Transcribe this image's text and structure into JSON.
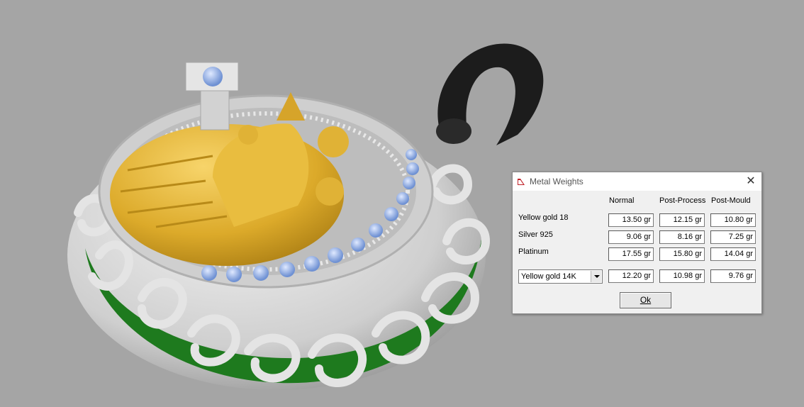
{
  "dialog": {
    "title": "Metal Weights",
    "close_glyph": "✕",
    "columns": [
      "Normal",
      "Post-Process",
      "Post-Mould"
    ],
    "rows": [
      {
        "label": "Yellow gold 18",
        "values": [
          "13.50 gr",
          "12.15 gr",
          "10.80 gr"
        ]
      },
      {
        "label": "Silver 925",
        "values": [
          "9.06 gr",
          "8.16 gr",
          "7.25 gr"
        ]
      },
      {
        "label": "Platinum",
        "values": [
          "17.55 gr",
          "15.80 gr",
          "14.04 gr"
        ]
      }
    ],
    "custom": {
      "selected_metal": "Yellow gold 14K",
      "values": [
        "12.20 gr",
        "10.98 gr",
        "9.76 gr"
      ]
    },
    "ok_label": "Ok"
  },
  "viewport": {
    "background_color": "#a5a5a5",
    "model": "pendant",
    "colors": {
      "silver": "#d8d8d8",
      "gold": "#e2b431",
      "enamel": "#1e7a1e",
      "stones": "#8fb0e6",
      "bail": "#1c1c1c"
    }
  },
  "icons": {
    "title_icon": "metal-weights-app-icon"
  }
}
